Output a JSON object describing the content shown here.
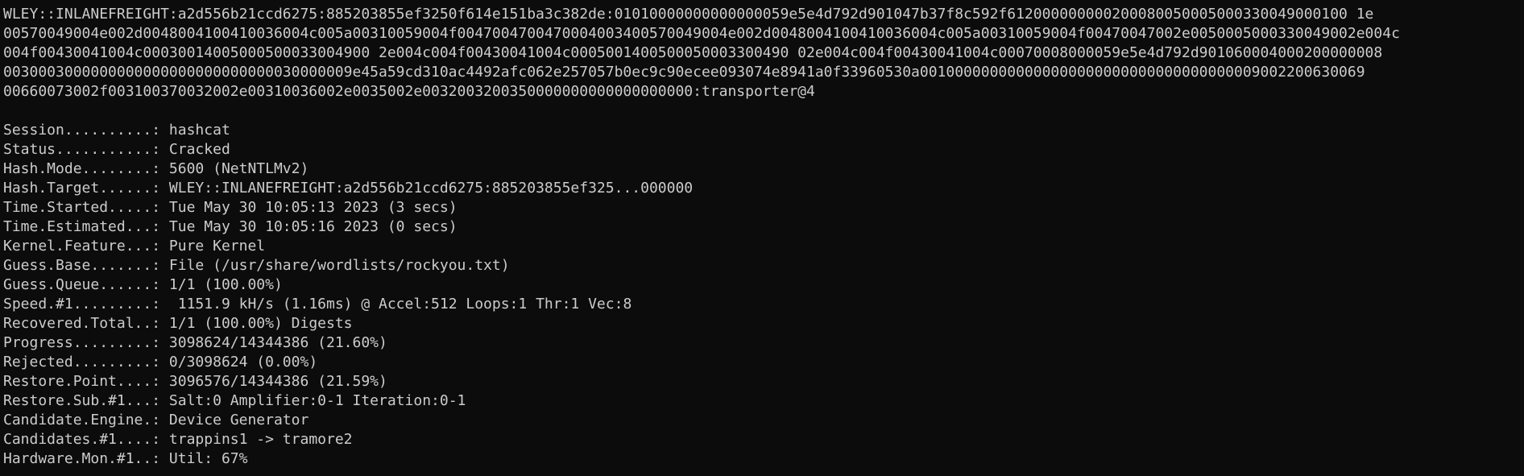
{
  "terminal": {
    "hash_lines": [
      "WLEY::INLANEFREIGHT:a2d556b21ccd6275:885203855ef3250f614e151ba3c382de:01010000000000000059e5e4d792d901047b37f8c592f612000000000200080050005000330049000100 1e",
      "00570049004e002d0048004100410036004c005a00310059004f0047004700470004003400570049004e002d0048004100410036004c005a00310059004f00470047002e0050005000330049002e004c",
      "004f00430041004c00030014005000500033004900 2e004c004f00430041004c0005001400500050003300490 02e004c004f00430041004c00070008000059e5e4d792d901060004000200000008",
      "0030003000000000000000000000000030000009e45a59cd310ac4492afc062e257057b0ec9c90ecee093074e8941a0f33960530a001000000000000000000000000000000000009002200630069",
      "00660073002f003100370032002e00310036002e0035002e0032003200350000000000000000000:transporter@4"
    ],
    "status": [
      {
        "key": "Session..........:",
        "value": "hashcat"
      },
      {
        "key": "Status...........:",
        "value": "Cracked"
      },
      {
        "key": "Hash.Mode........:",
        "value": "5600 (NetNTLMv2)"
      },
      {
        "key": "Hash.Target......:",
        "value": "WLEY::INLANEFREIGHT:a2d556b21ccd6275:885203855ef325...000000"
      },
      {
        "key": "Time.Started.....:",
        "value": "Tue May 30 10:05:13 2023 (3 secs)"
      },
      {
        "key": "Time.Estimated...:",
        "value": "Tue May 30 10:05:16 2023 (0 secs)"
      },
      {
        "key": "Kernel.Feature...:",
        "value": "Pure Kernel"
      },
      {
        "key": "Guess.Base.......:",
        "value": "File (/usr/share/wordlists/rockyou.txt)"
      },
      {
        "key": "Guess.Queue......:",
        "value": "1/1 (100.00%)"
      },
      {
        "key": "Speed.#1.........:",
        "value": " 1151.9 kH/s (1.16ms) @ Accel:512 Loops:1 Thr:1 Vec:8"
      },
      {
        "key": "Recovered.Total..:",
        "value": "1/1 (100.00%) Digests"
      },
      {
        "key": "Progress.........:",
        "value": "3098624/14344386 (21.60%)"
      },
      {
        "key": "Rejected.........:",
        "value": "0/3098624 (0.00%)"
      },
      {
        "key": "Restore.Point....:",
        "value": "3096576/14344386 (21.59%)"
      },
      {
        "key": "Restore.Sub.#1...:",
        "value": "Salt:0 Amplifier:0-1 Iteration:0-1"
      },
      {
        "key": "Candidate.Engine.:",
        "value": "Device Generator"
      },
      {
        "key": "Candidates.#1....:",
        "value": "trappins1 -> tramore2"
      },
      {
        "key": "Hardware.Mon.#1..:",
        "value": "Util: 67%"
      }
    ]
  },
  "colors": {
    "background": "#0c0c0c",
    "foreground": "#cccccc"
  }
}
